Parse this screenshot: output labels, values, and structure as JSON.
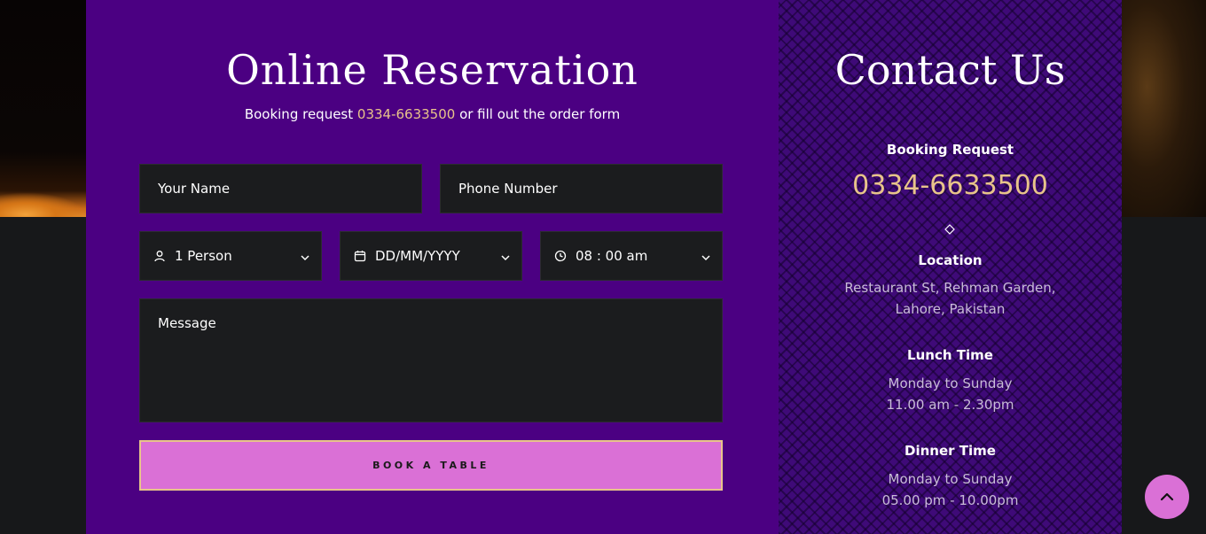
{
  "reservation": {
    "title": "Online Reservation",
    "subtitle_prefix": "Booking request ",
    "subtitle_phone": "0334-6633500",
    "subtitle_suffix": " or fill out the order form",
    "name_placeholder": "Your Name",
    "phone_placeholder": "Phone Number",
    "person_value": "1 Person",
    "date_value": "DD/MM/YYYY",
    "time_value": "08 : 00 am",
    "message_placeholder": "Message",
    "submit_label": "BOOK A TABLE"
  },
  "contact": {
    "title": "Contact Us",
    "booking_heading": "Booking Request",
    "booking_phone": "0334-6633500",
    "location_heading": "Location",
    "location_line1": "Restaurant St, Rehman Garden,",
    "location_line2": "Lahore, Pakistan",
    "lunch_heading": "Lunch Time",
    "lunch_days": "Monday to Sunday",
    "lunch_hours": "11.00 am - 2.30pm",
    "dinner_heading": "Dinner Time",
    "dinner_days": "Monday to Sunday",
    "dinner_hours": "05.00 pm - 10.00pm"
  },
  "icons": {
    "person": "user-icon",
    "date": "calendar-icon",
    "time": "clock-icon",
    "dropdown": "chevron-down-icon",
    "separator": "diamond-icon",
    "scroll_top": "chevron-up-icon"
  },
  "colors": {
    "panel_purple": "#4b0082",
    "accent_gold": "#e8c48a",
    "button_orchid": "#da70d6",
    "field_dark": "#1b1c1e"
  }
}
